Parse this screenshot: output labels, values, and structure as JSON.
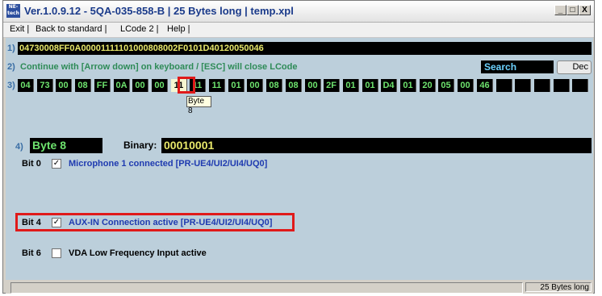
{
  "window": {
    "icon_text_1": "NE-",
    "icon_text_2": "tech",
    "title": "Ver.1.0.9.12 -  5QA-035-858-B | 25 Bytes long | temp.xpl",
    "btn_min": "_",
    "btn_max": "□",
    "btn_close": "X"
  },
  "menu": {
    "exit": "Exit |",
    "back": "Back to standard |",
    "lcode2": "LCode 2 |",
    "help": "Help |"
  },
  "row1": {
    "num": "1)",
    "hex": "04730008FF0A00001111101000808002F0101D40120050046"
  },
  "row2": {
    "num": "2)",
    "hint": "Continue with [Arrow down] on keyboard / [ESC] will close LCode",
    "search": "Search",
    "dec": "Dec"
  },
  "row3": {
    "num": "3)",
    "bytes": [
      "04",
      "73",
      "00",
      "08",
      "FF",
      "0A",
      "00",
      "00",
      "11",
      "11",
      "11",
      "01",
      "00",
      "08",
      "08",
      "00",
      "2F",
      "01",
      "01",
      "D4",
      "01",
      "20",
      "05",
      "00",
      "46",
      "",
      "",
      "",
      "",
      ""
    ],
    "selected_index": 8,
    "tooltip": "Byte 8"
  },
  "row4": {
    "num": "4)",
    "byte_label": "Byte 8",
    "binary_label": "Binary:",
    "binary_value": "00010001"
  },
  "bits": [
    {
      "bit": "Bit 0",
      "checked": true,
      "check_mark": "✓",
      "label": "Microphone 1 connected [PR-UE4/UI2/UI4/UQ0]"
    },
    {
      "bit": "Bit 4",
      "checked": true,
      "check_mark": "✓",
      "label": "AUX-IN Connection active [PR-UE4/UI2/UI4/UQ0]"
    },
    {
      "bit": "Bit 6",
      "checked": false,
      "check_mark": "",
      "label": "VDA Low Frequency Input active"
    }
  ],
  "status": {
    "right": "25 Bytes long"
  },
  "colors": {
    "panel_bg": "#bccfdb",
    "highlight": "#e01a1a",
    "hex_text": "#e8e86a",
    "cell_text": "#6ee36e",
    "blue_text": "#1f3bb0"
  }
}
